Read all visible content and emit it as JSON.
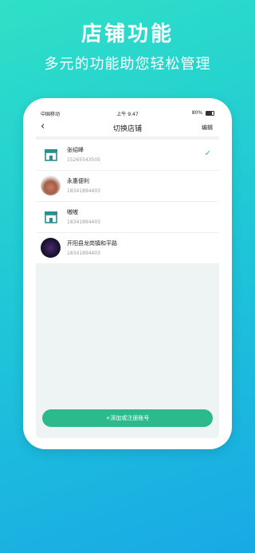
{
  "hero": {
    "title": "店铺功能",
    "subtitle": "多元的功能助您轻松管理"
  },
  "status_bar": {
    "carrier": "中国移动",
    "time": "上午 9:47",
    "battery": "80%"
  },
  "nav": {
    "back_icon": "chevron-left-icon",
    "title": "切换店铺",
    "edit_label": "编辑"
  },
  "stores": [
    {
      "name": "张绍峰",
      "phone": "15265543505",
      "avatar": "store-icon",
      "selected": true
    },
    {
      "name": "永惠便利",
      "phone": "18341894403",
      "avatar": "photo",
      "selected": false
    },
    {
      "name": "嗷嗷",
      "phone": "18341894403",
      "avatar": "store-icon",
      "selected": false
    },
    {
      "name": "开阳县龙岗镇和平路",
      "phone": "18341894403",
      "avatar": "photo",
      "selected": false
    }
  ],
  "add_button_label": "+添加或注册账号",
  "colors": {
    "accent": "#2cb98c",
    "background_start": "#2fe0c6",
    "background_end": "#19a9e6"
  }
}
